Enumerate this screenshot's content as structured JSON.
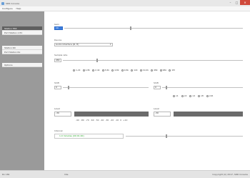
{
  "window": {
    "title": "SDR Console",
    "min": "–",
    "max": "□",
    "close": "✕"
  },
  "menu": [
    "Configure",
    "Help"
  ],
  "sidebar": {
    "group1": [
      {
        "label": "Station TRX"
      },
      {
        "label": "Port Station 1 PC"
      }
    ],
    "group2": [
      {
        "label": "Station RX"
      },
      {
        "label": "Port Station Rx"
      }
    ],
    "group3": [
      {
        "label": "Options"
      }
    ]
  },
  "main": {
    "gain": {
      "label": "Gain",
      "value": "10"
    },
    "device": {
      "label": "Device",
      "value": "Audio Interface (R, H)"
    },
    "sample_rate": {
      "label": "Sample rate",
      "value": "48k"
    },
    "rates": [
      "1,2k",
      "1,8k",
      "2,4k",
      "3,6k",
      "4,8k",
      "9,6k",
      "12k",
      "19,2k",
      "48k",
      "96k",
      "1M"
    ],
    "shift_left": {
      "label": "Shift",
      "value": "0"
    },
    "shift_right": {
      "label": "Shift",
      "value": "0"
    },
    "right_opts": [
      "x1",
      "x2",
      "x4",
      "x8",
      "x16"
    ],
    "level_left": {
      "label": "Level",
      "value": "-30"
    },
    "level_right": {
      "label": "Level",
      "value": "-30"
    },
    "scale": [
      "-90",
      "-80",
      "-70",
      "-60",
      "-50",
      "-40",
      "-30",
      "-20",
      "-10",
      "0",
      "+10"
    ],
    "timer": {
      "label": "Interval",
      "value": "1.0 minutes (00:01:00)"
    }
  },
  "status": {
    "left": "Rx 18k",
    "mid": "Idle",
    "right": "Copyright (C) 2017, SDR Console"
  },
  "colors": {
    "accent": "#3b7ddd",
    "close": "#d04a3c",
    "hint_text": "#1ca01c"
  }
}
